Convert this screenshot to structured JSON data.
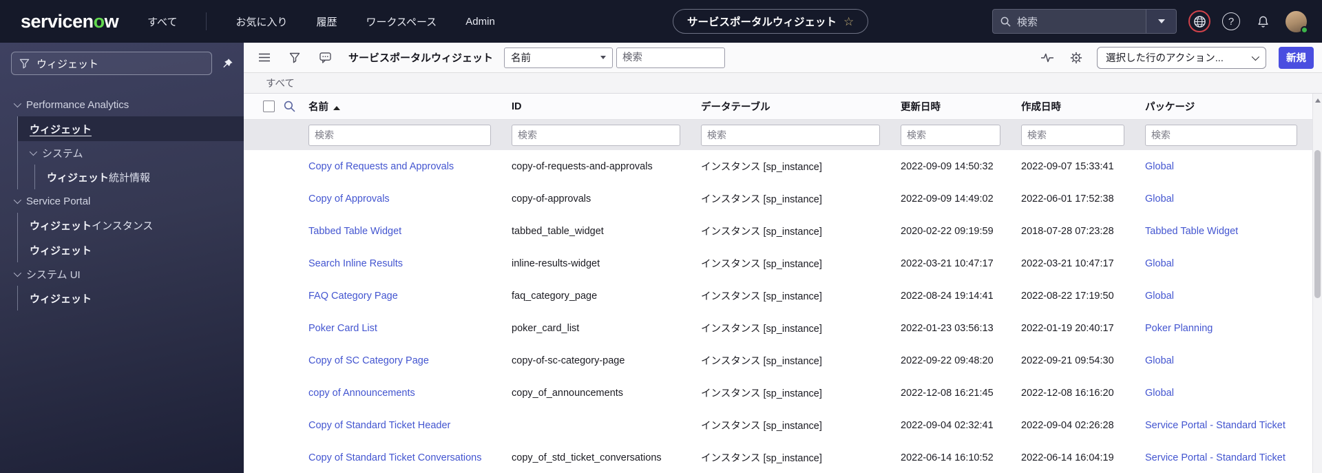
{
  "header": {
    "logo": {
      "pre": "servicen",
      "accent": "o",
      "post": "w"
    },
    "nav": [
      {
        "label": "すべて"
      },
      {
        "label": "お気に入り"
      },
      {
        "label": "履歴"
      },
      {
        "label": "ワークスペース"
      },
      {
        "label": "Admin"
      }
    ],
    "context_pill": {
      "label": "サービスポータルウィジェット",
      "star": "☆"
    },
    "search": {
      "placeholder": "検索"
    }
  },
  "sidebar": {
    "filter_value": "ウィジェット",
    "tree": [
      {
        "type": "section",
        "label": "Performance Analytics"
      },
      {
        "type": "module",
        "match": "ウィジェット",
        "rest": "",
        "selected": true
      },
      {
        "type": "section",
        "label": "システム"
      },
      {
        "type": "module",
        "match": "ウィジェット",
        "rest": "統計情報"
      },
      {
        "type": "section",
        "label": "Service Portal"
      },
      {
        "type": "module",
        "match": "ウィジェット",
        "rest": "インスタンス"
      },
      {
        "type": "module",
        "match": "ウィジェット",
        "rest": ""
      },
      {
        "type": "section",
        "label": "システム UI"
      },
      {
        "type": "module",
        "match": "ウィジェット",
        "rest": ""
      }
    ]
  },
  "toolbar": {
    "title": "サービスポータルウィジェット",
    "field_selector_value": "名前",
    "search_placeholder": "検索",
    "row_actions_label": "選択した行のアクション...",
    "new_button_label": "新規"
  },
  "list": {
    "breadcrumb": "すべて",
    "columns": [
      "名前",
      "ID",
      "データテーブル",
      "更新日時",
      "作成日時",
      "パッケージ"
    ],
    "sorted_column": "名前",
    "sort_direction": "asc",
    "filter_placeholder": "検索",
    "rows": [
      {
        "name": "Copy of Requests and Approvals",
        "id": "copy-of-requests-and-approvals",
        "table": "インスタンス [sp_instance]",
        "updated": "2022-09-09 14:50:32",
        "created": "2022-09-07 15:33:41",
        "package": "Global"
      },
      {
        "name": "Copy of Approvals",
        "id": "copy-of-approvals",
        "table": "インスタンス [sp_instance]",
        "updated": "2022-09-09 14:49:02",
        "created": "2022-06-01 17:52:38",
        "package": "Global"
      },
      {
        "name": "Tabbed Table Widget",
        "id": "tabbed_table_widget",
        "table": "インスタンス [sp_instance]",
        "updated": "2020-02-22 09:19:59",
        "created": "2018-07-28 07:23:28",
        "package": "Tabbed Table Widget"
      },
      {
        "name": "Search Inline Results",
        "id": "inline-results-widget",
        "table": "インスタンス [sp_instance]",
        "updated": "2022-03-21 10:47:17",
        "created": "2022-03-21 10:47:17",
        "package": "Global"
      },
      {
        "name": "FAQ Category Page",
        "id": "faq_category_page",
        "table": "インスタンス [sp_instance]",
        "updated": "2022-08-24 19:14:41",
        "created": "2022-08-22 17:19:50",
        "package": "Global"
      },
      {
        "name": "Poker Card List",
        "id": "poker_card_list",
        "table": "インスタンス [sp_instance]",
        "updated": "2022-01-23 03:56:13",
        "created": "2022-01-19 20:40:17",
        "package": "Poker Planning"
      },
      {
        "name": "Copy of SC Category Page",
        "id": "copy-of-sc-category-page",
        "table": "インスタンス [sp_instance]",
        "updated": "2022-09-22 09:48:20",
        "created": "2022-09-21 09:54:30",
        "package": "Global"
      },
      {
        "name": "copy of Announcements",
        "id": "copy_of_announcements",
        "table": "インスタンス [sp_instance]",
        "updated": "2022-12-08 16:21:45",
        "created": "2022-12-08 16:16:20",
        "package": "Global"
      },
      {
        "name": "Copy of Standard Ticket Header",
        "id": "",
        "table": "インスタンス [sp_instance]",
        "updated": "2022-09-04 02:32:41",
        "created": "2022-09-04 02:26:28",
        "package": "Service Portal - Standard Ticket"
      },
      {
        "name": "Copy of Standard Ticket Conversations",
        "id": "copy_of_std_ticket_conversations",
        "table": "インスタンス [sp_instance]",
        "updated": "2022-06-14 16:10:52",
        "created": "2022-06-14 16:04:19",
        "package": "Service Portal - Standard Ticket"
      }
    ]
  },
  "colors": {
    "header_bg": "#151929",
    "logo_accent": "#62d84e",
    "sidebar_bg": "#353852",
    "link": "#4355d0",
    "primary_button": "#4a4ee0",
    "globe_ring": "#d2434b",
    "presence_green": "#3cb54a"
  }
}
